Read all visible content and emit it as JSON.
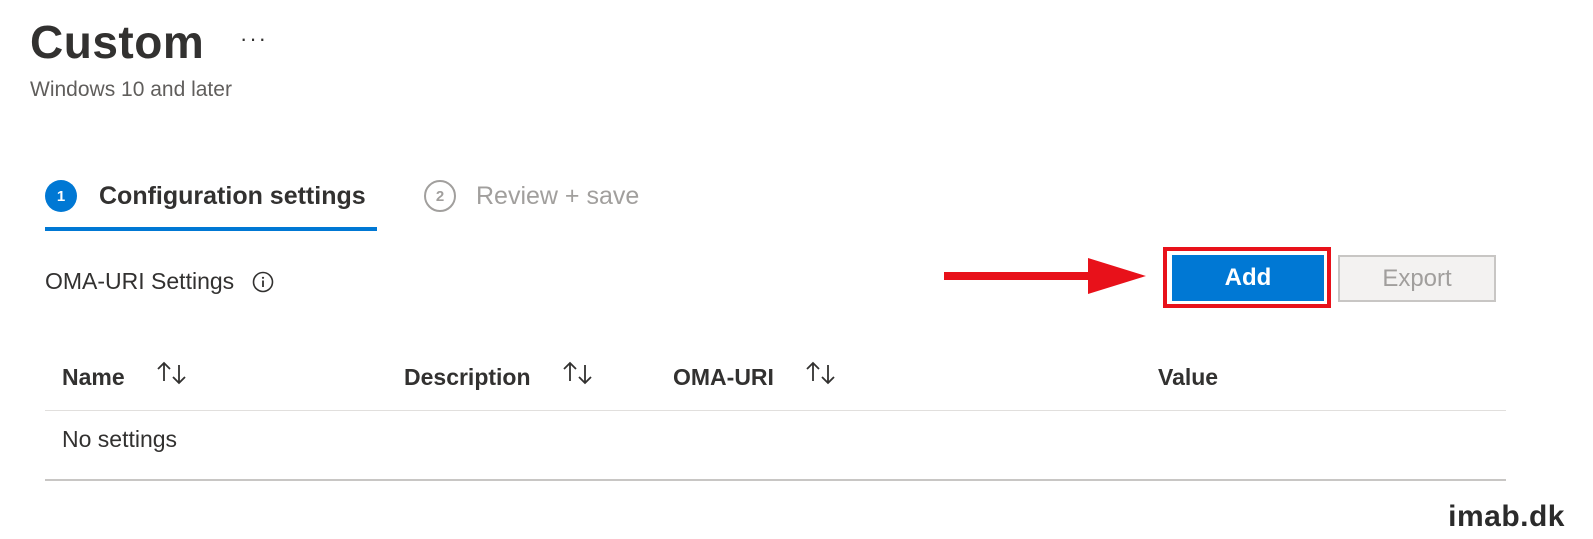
{
  "header": {
    "title": "Custom",
    "more_label": "···",
    "subtitle": "Windows 10 and later"
  },
  "steps": [
    {
      "number": "1",
      "label": "Configuration settings",
      "state": "active"
    },
    {
      "number": "2",
      "label": "Review + save",
      "state": "inactive"
    }
  ],
  "section": {
    "label": "OMA-URI Settings",
    "info_icon": "info-icon"
  },
  "toolbar": {
    "add_label": "Add",
    "export_label": "Export"
  },
  "annotation": {
    "arrow_color": "#e8111a",
    "highlight_color": "#e8111a"
  },
  "table": {
    "columns": [
      {
        "label": "Name",
        "sortable": true
      },
      {
        "label": "Description",
        "sortable": true
      },
      {
        "label": "OMA-URI",
        "sortable": true
      },
      {
        "label": "Value",
        "sortable": false
      }
    ],
    "empty_text": "No settings"
  },
  "watermark": "imab.dk",
  "colors": {
    "accent": "#0078d4",
    "text": "#323130",
    "muted": "#a19f9d"
  }
}
